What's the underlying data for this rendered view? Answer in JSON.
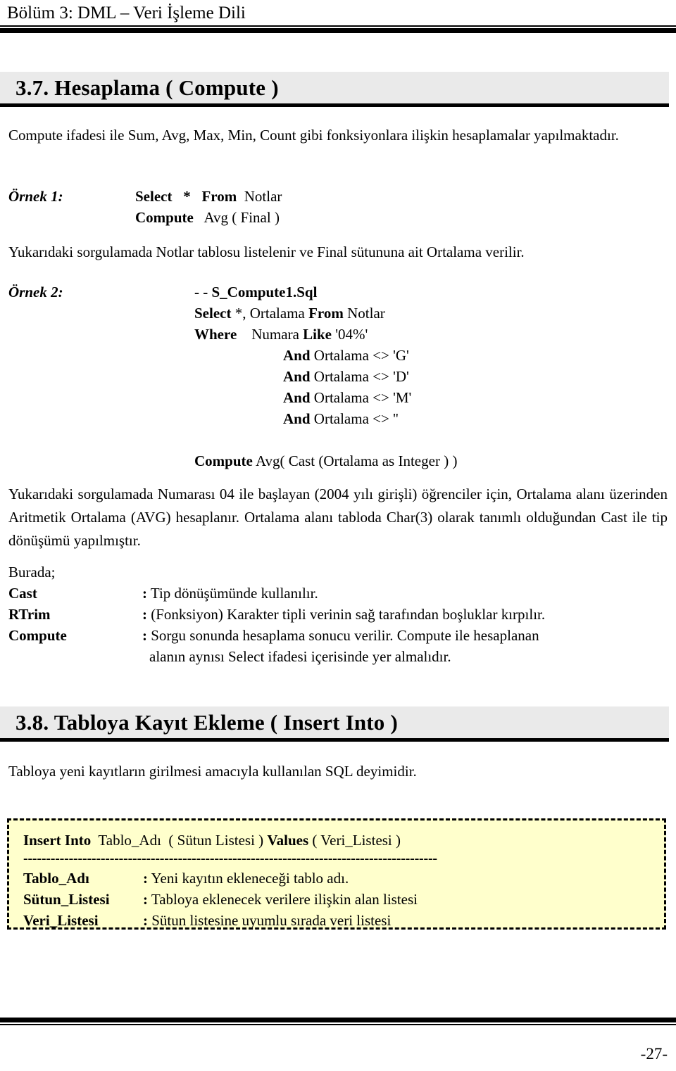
{
  "header": {
    "title": "Bölüm 3: DML – Veri İşleme Dili"
  },
  "footer": {
    "page_number": "-27-"
  },
  "sections": {
    "compute": {
      "heading": "3.7. Hesaplama ( Compute )",
      "intro": "Compute ifadesi ile Sum, Avg, Max, Min, Count gibi fonksiyonlara ilişkin hesaplamalar yapılmaktadır.",
      "example1": {
        "label": "Örnek 1:",
        "line1_kw1": "Select",
        "line1_star": "*",
        "line1_kw2": "From",
        "line1_table": "Notlar",
        "line2_kw": "Compute",
        "line2_expr": "Avg ( Final )",
        "explanation": "Yukarıdaki sorgulamada Notlar tablosu listelenir ve Final sütununa ait Ortalama verilir."
      },
      "example2": {
        "label": "Örnek 2:",
        "comment": "- - S_Compute1.Sql",
        "select_kw": "Select",
        "select_cols": "*, Ortalama",
        "from_kw": "From",
        "from_table": "Notlar",
        "where_kw": "Where",
        "where_expr_a": "Numara",
        "where_kw_like": "Like",
        "where_expr_b": "'04%'",
        "and_lines": [
          {
            "kw": "And",
            "expr": "Ortalama <> 'G'"
          },
          {
            "kw": "And",
            "expr": "Ortalama <> 'D'"
          },
          {
            "kw": "And",
            "expr": "Ortalama <> 'M'"
          },
          {
            "kw": "And",
            "expr": "Ortalama <> ''"
          }
        ],
        "compute_kw": "Compute",
        "compute_expr": "Avg( Cast (Ortalama as Integer ) )",
        "explanation": "Yukarıdaki sorgulamada Numarası 04 ile başlayan (2004 yılı girişli) öğrenciler için, Ortalama alanı üzerinden Aritmetik Ortalama (AVG) hesaplanır. Ortalama alanı tabloda Char(3) olarak tanımlı olduğundan Cast ile tip dönüşümü yapılmıştır."
      },
      "glossary": {
        "intro": "Burada;",
        "items": [
          {
            "term": "Cast",
            "colon": ":",
            "desc": "Tip dönüşümünde kullanılır."
          },
          {
            "term": "RTrim",
            "colon": ":",
            "desc": "(Fonksiyon) Karakter tipli verinin sağ tarafından boşluklar kırpılır."
          },
          {
            "term": "Compute",
            "colon": ":",
            "desc": "Sorgu sonunda hesaplama sonucu verilir. Compute ile hesaplanan",
            "desc_line2": "alanın aynısı Select ifadesi içerisinde yer almalıdır."
          }
        ]
      }
    },
    "insert": {
      "heading": "3.8. Tabloya Kayıt Ekleme ( Insert Into )",
      "intro": "Tabloya yeni kayıtların girilmesi amacıyla kullanılan SQL deyimidir.",
      "syntax_box": {
        "kw1": "Insert Into",
        "table": "Tablo_Adı",
        "cols": "( Sütun Listesi )",
        "kw2": "Values",
        "values": "( Veri_Listesi )",
        "divider": "-------------------------------------------------------------------------------------------",
        "items": [
          {
            "term": "Tablo_Adı",
            "colon": ":",
            "desc": "Yeni kayıtın ekleneceği tablo adı."
          },
          {
            "term": "Sütun_Listesi",
            "colon": ":",
            "desc": "Tabloya eklenecek verilere ilişkin alan listesi"
          },
          {
            "term": "Veri_Listesi",
            "colon": ":",
            "desc": "Sütun listesine uyumlu sırada veri listesi"
          }
        ]
      }
    }
  }
}
